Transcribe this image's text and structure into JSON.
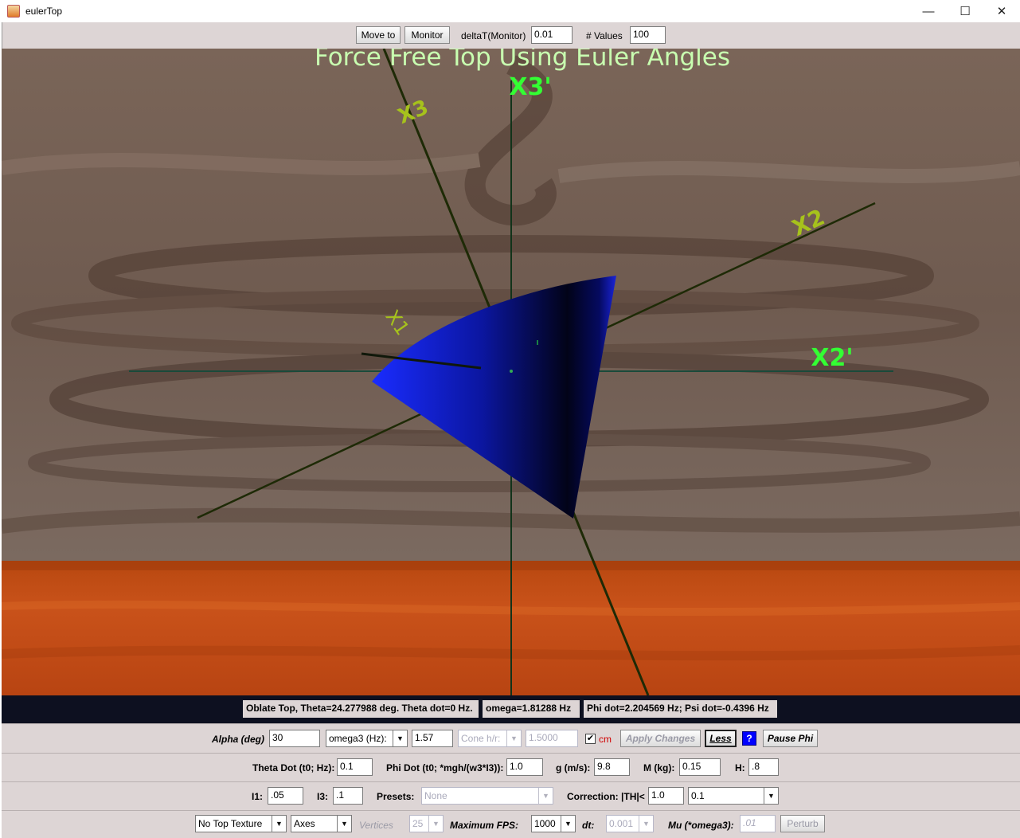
{
  "window": {
    "title": "eulerTop",
    "minimize": "—",
    "maximize": "☐",
    "close": "✕"
  },
  "toolbar": {
    "move_to": "Move to",
    "monitor": "Monitor",
    "deltat_label": "deltaT(Monitor)",
    "deltat_value": "0.01",
    "values_label": "# Values",
    "values_value": "100"
  },
  "scene": {
    "title": "Force Free Top Using Euler Angles",
    "axis_labels": {
      "x3p": "X3'",
      "x2p": "X2'",
      "x3": "X3",
      "x2": "X2",
      "x1": "X1"
    },
    "colors": {
      "title": "#c8ffb0",
      "prime_axis": "#33ff33",
      "body_axis": "#a6c21c",
      "top": "#1020ff",
      "floor": "#c24a10"
    }
  },
  "status": {
    "oblate": "Oblate Top, Theta=24.277988 deg. Theta dot=0 Hz.",
    "omega": "omega=1.81288 Hz",
    "phi": "Phi dot=2.204569 Hz;  Psi dot=-0.4396 Hz"
  },
  "controls": {
    "row1": {
      "alpha_label": "Alpha (deg)",
      "alpha_value": "30",
      "omega_select": "omega3 (Hz):",
      "omega_value": "1.57",
      "cone_select": "Cone h/r:",
      "cone_value": "1.5000",
      "cm_label": "cm",
      "cm_checked": "✔",
      "apply": "Apply Changes",
      "less": "Less",
      "help": "?",
      "pause": "Pause Phi"
    },
    "row2": {
      "theta_label": "Theta Dot (t0; Hz):",
      "theta_value": "0.1",
      "phi_label": "Phi Dot (t0; *mgh/(w3*I3)):",
      "phi_value": "1.0",
      "g_label": "g (m/s):",
      "g_value": "9.8",
      "m_label": "M (kg):",
      "m_value": "0.15",
      "h_label": "H:",
      "h_value": ".8"
    },
    "row3": {
      "i1_label": "I1:",
      "i1_value": ".05",
      "i3_label": "I3:",
      "i3_value": ".1",
      "presets_label": "Presets:",
      "presets_value": "None",
      "correction_label": "Correction: |TH|<",
      "correction_value": "1.0",
      "correction_select": "0.1"
    },
    "row4": {
      "texture_select": "No Top Texture",
      "axes_select": "Axes",
      "vertices_label": "Vertices",
      "vertices_value": "25",
      "fps_label": "Maximum FPS:",
      "fps_value": "1000",
      "dt_label": "dt:",
      "dt_value": "0.001",
      "mu_label": "Mu (*omega3):",
      "mu_value": ".01",
      "perturb": "Perturb"
    }
  }
}
